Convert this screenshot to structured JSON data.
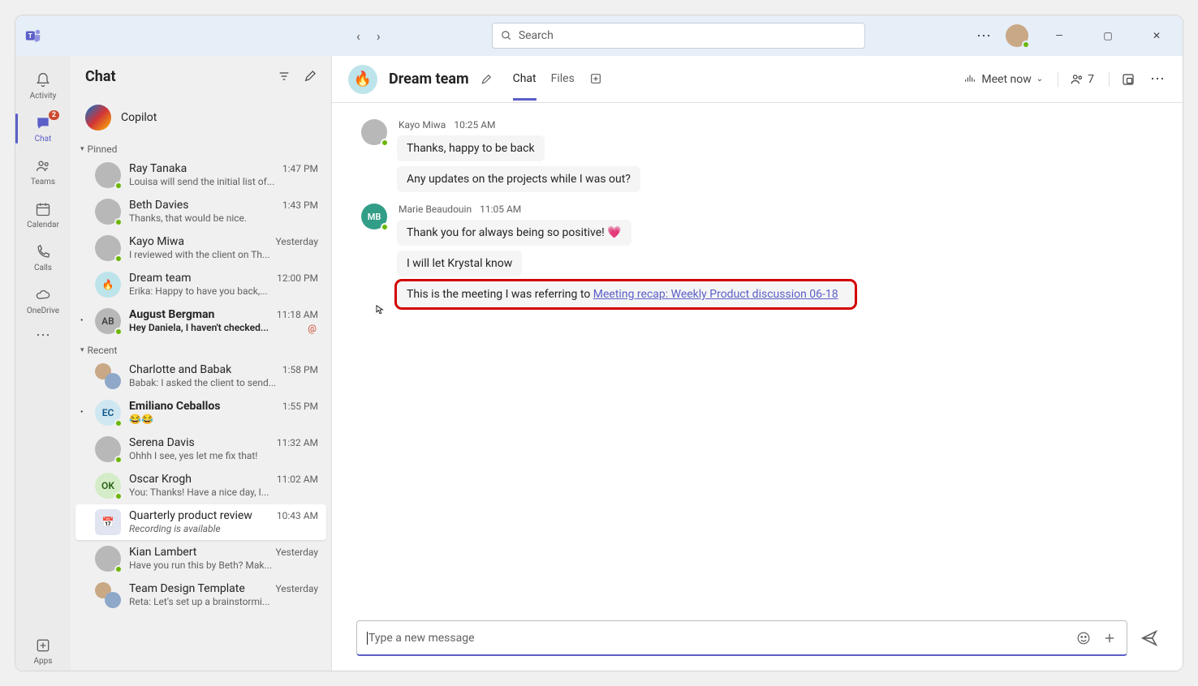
{
  "titlebar": {
    "search_placeholder": "Search"
  },
  "rail": {
    "activity": "Activity",
    "chat": "Chat",
    "chat_badge": "2",
    "teams": "Teams",
    "calendar": "Calendar",
    "calls": "Calls",
    "onedrive": "OneDrive",
    "apps": "Apps"
  },
  "chatlist": {
    "title": "Chat",
    "copilot": "Copilot",
    "pinned_label": "Pinned",
    "recent_label": "Recent",
    "pinned": [
      {
        "name": "Ray Tanaka",
        "preview": "Louisa will send the initial list of...",
        "time": "1:47 PM",
        "initials": "",
        "unread": false
      },
      {
        "name": "Beth Davies",
        "preview": "Thanks, that would be nice.",
        "time": "1:43 PM",
        "initials": "",
        "unread": false
      },
      {
        "name": "Kayo Miwa",
        "preview": "I reviewed with the client on Th...",
        "time": "Yesterday",
        "initials": "",
        "unread": false
      },
      {
        "name": "Dream team",
        "preview": "Erika: Happy to have you back,...",
        "time": "12:00 PM",
        "initials": "🔥",
        "unread": false,
        "fire": true
      },
      {
        "name": "August Bergman",
        "preview": "Hey Daniela, I haven't checked...",
        "time": "11:18 AM",
        "initials": "AB",
        "unread": true,
        "mention": true
      }
    ],
    "recent": [
      {
        "name": "Charlotte and Babak",
        "preview": "Babak: I asked the client to send...",
        "time": "1:58 PM",
        "initials": "",
        "unread": false,
        "group": true
      },
      {
        "name": "Emiliano Ceballos",
        "preview": "😂😂",
        "time": "1:55 PM",
        "initials": "EC",
        "unread": true,
        "ec": true
      },
      {
        "name": "Serena Davis",
        "preview": "Ohhh I see, yes let me fix that!",
        "time": "11:32 AM",
        "initials": "",
        "unread": false
      },
      {
        "name": "Oscar Krogh",
        "preview": "You: Thanks! Have a nice day, I...",
        "time": "11:02 AM",
        "initials": "OK",
        "unread": false,
        "ok": true
      },
      {
        "name": "Quarterly product review",
        "preview": "Recording is available",
        "time": "10:43 AM",
        "initials": "📅",
        "unread": false,
        "selected": true,
        "cal": true,
        "italic": true
      },
      {
        "name": "Kian Lambert",
        "preview": "Have you run this by Beth? Mak...",
        "time": "Yesterday",
        "initials": "",
        "unread": false
      },
      {
        "name": "Team Design Template",
        "preview": "Reta: Let's set up a brainstormi...",
        "time": "Yesterday",
        "initials": "",
        "unread": false,
        "group": true
      }
    ]
  },
  "chat": {
    "title": "Dream team",
    "tab_chat": "Chat",
    "tab_files": "Files",
    "meet_now": "Meet now",
    "people_count": "7",
    "groups": [
      {
        "author": "Kayo Miwa",
        "time": "10:25 AM",
        "avatar": "",
        "bubbles": [
          {
            "text": "Thanks, happy to be back"
          },
          {
            "text": "Any updates on the projects while I was out?"
          }
        ]
      },
      {
        "author": "Marie Beaudouin",
        "time": "11:05 AM",
        "avatar": "MB",
        "mb": true,
        "bubbles": [
          {
            "text": "Thank you for always being so positive! 💗"
          },
          {
            "text": "I will let Krystal know"
          },
          {
            "text_pre": "This is the meeting I was referring to ",
            "link": "Meeting recap: Weekly Product discussion 06-18",
            "highlight": true
          }
        ]
      }
    ]
  },
  "compose": {
    "placeholder": "Type a new message"
  }
}
